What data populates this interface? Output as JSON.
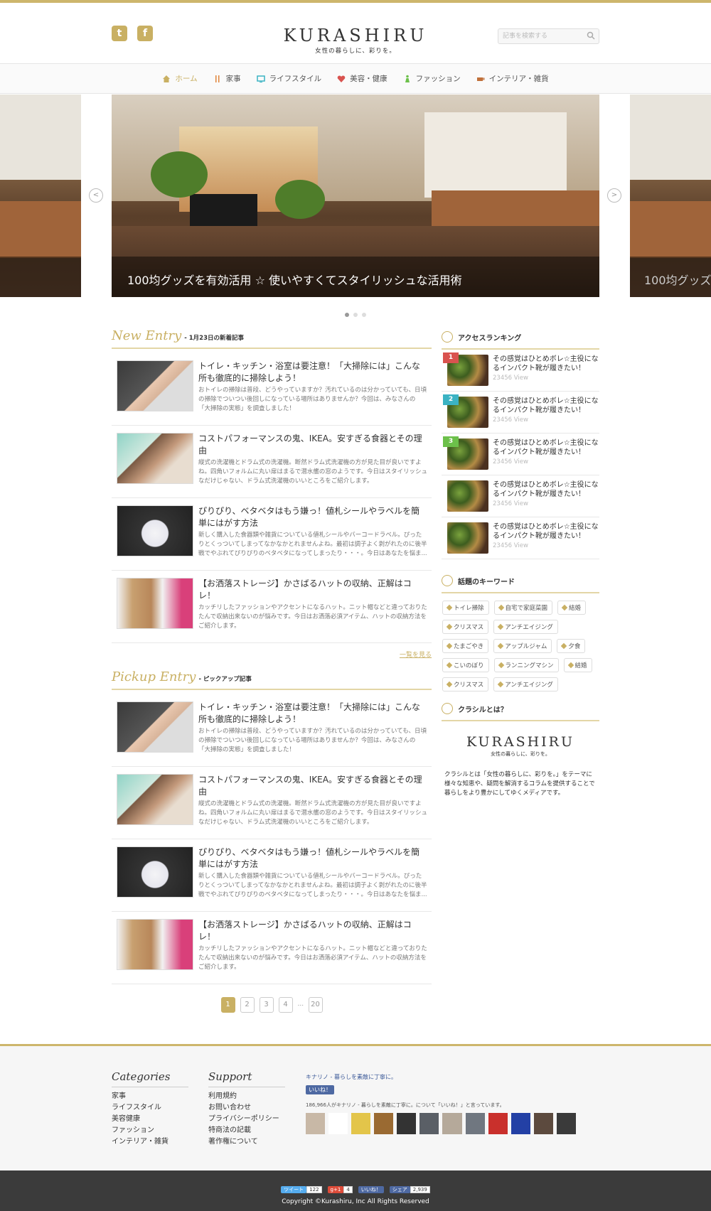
{
  "header": {
    "logo_title": "KURASHIRU",
    "logo_tagline": "女性の暮らしに、彩りを。",
    "search_placeholder": "記事を検索する",
    "social": [
      "twitter-icon",
      "facebook-icon"
    ]
  },
  "nav": {
    "items": [
      {
        "label": "ホーム",
        "icon": "home-icon",
        "active": true
      },
      {
        "label": "家事",
        "icon": "cutlery-icon"
      },
      {
        "label": "ライフスタイル",
        "icon": "monitor-icon"
      },
      {
        "label": "美容・健康",
        "icon": "heart-icon"
      },
      {
        "label": "ファッション",
        "icon": "person-icon"
      },
      {
        "label": "インテリア・雑貨",
        "icon": "cup-icon"
      }
    ]
  },
  "slider": {
    "caption": "100均グッズを有効活用 ☆ 使いやすくてスタイリッシュな活用術",
    "caption_right": "100均グッズ"
  },
  "new_entry": {
    "title_en": "New Entry",
    "title_jp": "- 1月23日の新着記事",
    "more": "一覧を見る",
    "articles": [
      {
        "title": "トイレ・キッチン・浴室は要注意！「大掃除には」こんな所も徹底的に掃除しよう！",
        "desc": "おトイレの掃除は普段、どうやっていますか？汚れているのは分かっていても、日頃の掃除でついつい後回しになっている場所はありませんか？今回は、みなさんの「大掃除の実態」を調査しました！"
      },
      {
        "title": "コストパフォーマンスの鬼、IKEA。安すぎる食器とその理由",
        "desc": "縦式の洗濯機とドラム式の洗濯機。断然ドラム式洗濯機の方が見た目が良いですよね。四角いフォルムに丸い扉はまるで潜水艦の窓のようです。今日はスタイリッシュなだけじゃない、ドラム式洗濯機のいいところをご紹介します。"
      },
      {
        "title": "ぴりぴり、ベタベタはもう嫌っ！値札シールやラベルを簡単にはがす方法",
        "desc": "新しく購入した食器類や雑貨についている値札シールやバーコードラベル。ぴったりとくっついてしまってなかなかとれませんよね。最初は調子よく剥がれたのに後半戦でやぶれてぴりぴりのベタベタになってしまったり・・・。今日はあなたを悩ま..."
      },
      {
        "title": "【お洒落ストレージ】かさばるハットの収納、正解はコレ！",
        "desc": "カッチリしたファッションやアクセントになるハット。ニット帽などと違っておりたたんで収納出来ないのが悩みです。今日はお洒落必須アイテム、ハットの収納方法をご紹介します。"
      }
    ]
  },
  "pickup_entry": {
    "title_en": "Pickup Entry",
    "title_jp": "- ピックアップ記事",
    "articles": [
      {
        "title": "トイレ・キッチン・浴室は要注意！「大掃除には」こんな所も徹底的に掃除しよう！",
        "desc": "おトイレの掃除は普段、どうやっていますか？汚れているのは分かっていても、日頃の掃除でついつい後回しになっている場所はありませんか？今回は、みなさんの「大掃除の実態」を調査しました！"
      },
      {
        "title": "コストパフォーマンスの鬼、IKEA。安すぎる食器とその理由",
        "desc": "縦式の洗濯機とドラム式の洗濯機。断然ドラム式洗濯機の方が見た目が良いですよね。四角いフォルムに丸い扉はまるで潜水艦の窓のようです。今日はスタイリッシュなだけじゃない、ドラム式洗濯機のいいところをご紹介します。"
      },
      {
        "title": "ぴりぴり、ベタベタはもう嫌っ！値札シールやラベルを簡単にはがす方法",
        "desc": "新しく購入した食器類や雑貨についている値札シールやバーコードラベル。ぴったりとくっついてしまってなかなかとれませんよね。最初は調子よく剥がれたのに後半戦でやぶれてぴりぴりのベタベタになってしまったり・・・。今日はあなたを悩ま..."
      },
      {
        "title": "【お洒落ストレージ】かさばるハットの収納、正解はコレ！",
        "desc": "カッチリしたファッションやアクセントになるハット。ニット帽などと違っておりたたんで収納出来ないのが悩みです。今日はお洒落必須アイテム、ハットの収納方法をご紹介します。"
      }
    ]
  },
  "pager": {
    "pages": [
      "1",
      "2",
      "3",
      "4",
      "...",
      "20"
    ],
    "current": "1"
  },
  "ranking": {
    "title": "アクセスランキング",
    "items": [
      {
        "rank": "1",
        "color": "#d9534f",
        "title": "その感覚はひとめボレ☆主役になるインパクト靴が履きたい！",
        "views": "23456 View"
      },
      {
        "rank": "2",
        "color": "#3bb3c3",
        "title": "その感覚はひとめボレ☆主役になるインパクト靴が履きたい！",
        "views": "23456 View"
      },
      {
        "rank": "3",
        "color": "#6cc04a",
        "title": "その感覚はひとめボレ☆主役になるインパクト靴が履きたい！",
        "views": "23456 View"
      },
      {
        "rank": "",
        "color": "",
        "title": "その感覚はひとめボレ☆主役になるインパクト靴が履きたい！",
        "views": "23456 View"
      },
      {
        "rank": "",
        "color": "",
        "title": "その感覚はひとめボレ☆主役になるインパクト靴が履きたい！",
        "views": "23456 View"
      }
    ]
  },
  "keywords": {
    "title": "話題のキーワード",
    "tags": [
      "トイレ掃除",
      "自宅で家庭菜園",
      "結婚",
      "クリスマス",
      "アンチエイジング",
      "たまごやき",
      "アップルジャム",
      "夕食",
      "こいのぼり",
      "ランニングマシン",
      "結婚",
      "クリスマス",
      "アンチエイジング"
    ]
  },
  "about": {
    "title": "クラシルとは？",
    "logo_title": "KURASHIRU",
    "logo_tagline": "女性の暮らしに、彩りを。",
    "text": "クラシルとは「女性の暮らしに、彩りを。」をテーマに様々な知恵や、疑問を解消するコラムを提供することで暮らしをより豊かにしてゆくメディアです。"
  },
  "footer": {
    "categories_title": "Categories",
    "categories": [
      "家事",
      "ライフスタイル",
      "美容健康",
      "ファッション",
      "インテリア・雑貨"
    ],
    "support_title": "Support",
    "support": [
      "利用規約",
      "お問い合わせ",
      "プライバシーポリシー",
      "特商法の記載",
      "著作権について"
    ],
    "fb_name": "キナリノ - 暮らしを素敵に丁寧に。",
    "fb_like": "いいね！",
    "fb_count": "186,966人がキナリノ - 暮らしを素敵に丁寧に。について「いいね！」と言っています。",
    "share": {
      "tweet": "ツイート",
      "tweet_count": "122",
      "gplus": "g+1",
      "gplus_count": "4",
      "fb_like": "いいね！",
      "fb_share": "シェア",
      "fb_count": "2,939"
    },
    "copyright": "Copyright ©Kurashiru, Inc All Rights Reserved"
  },
  "colors": {
    "accent": "#c9b063",
    "footer_bg": "#3b3b3b"
  }
}
